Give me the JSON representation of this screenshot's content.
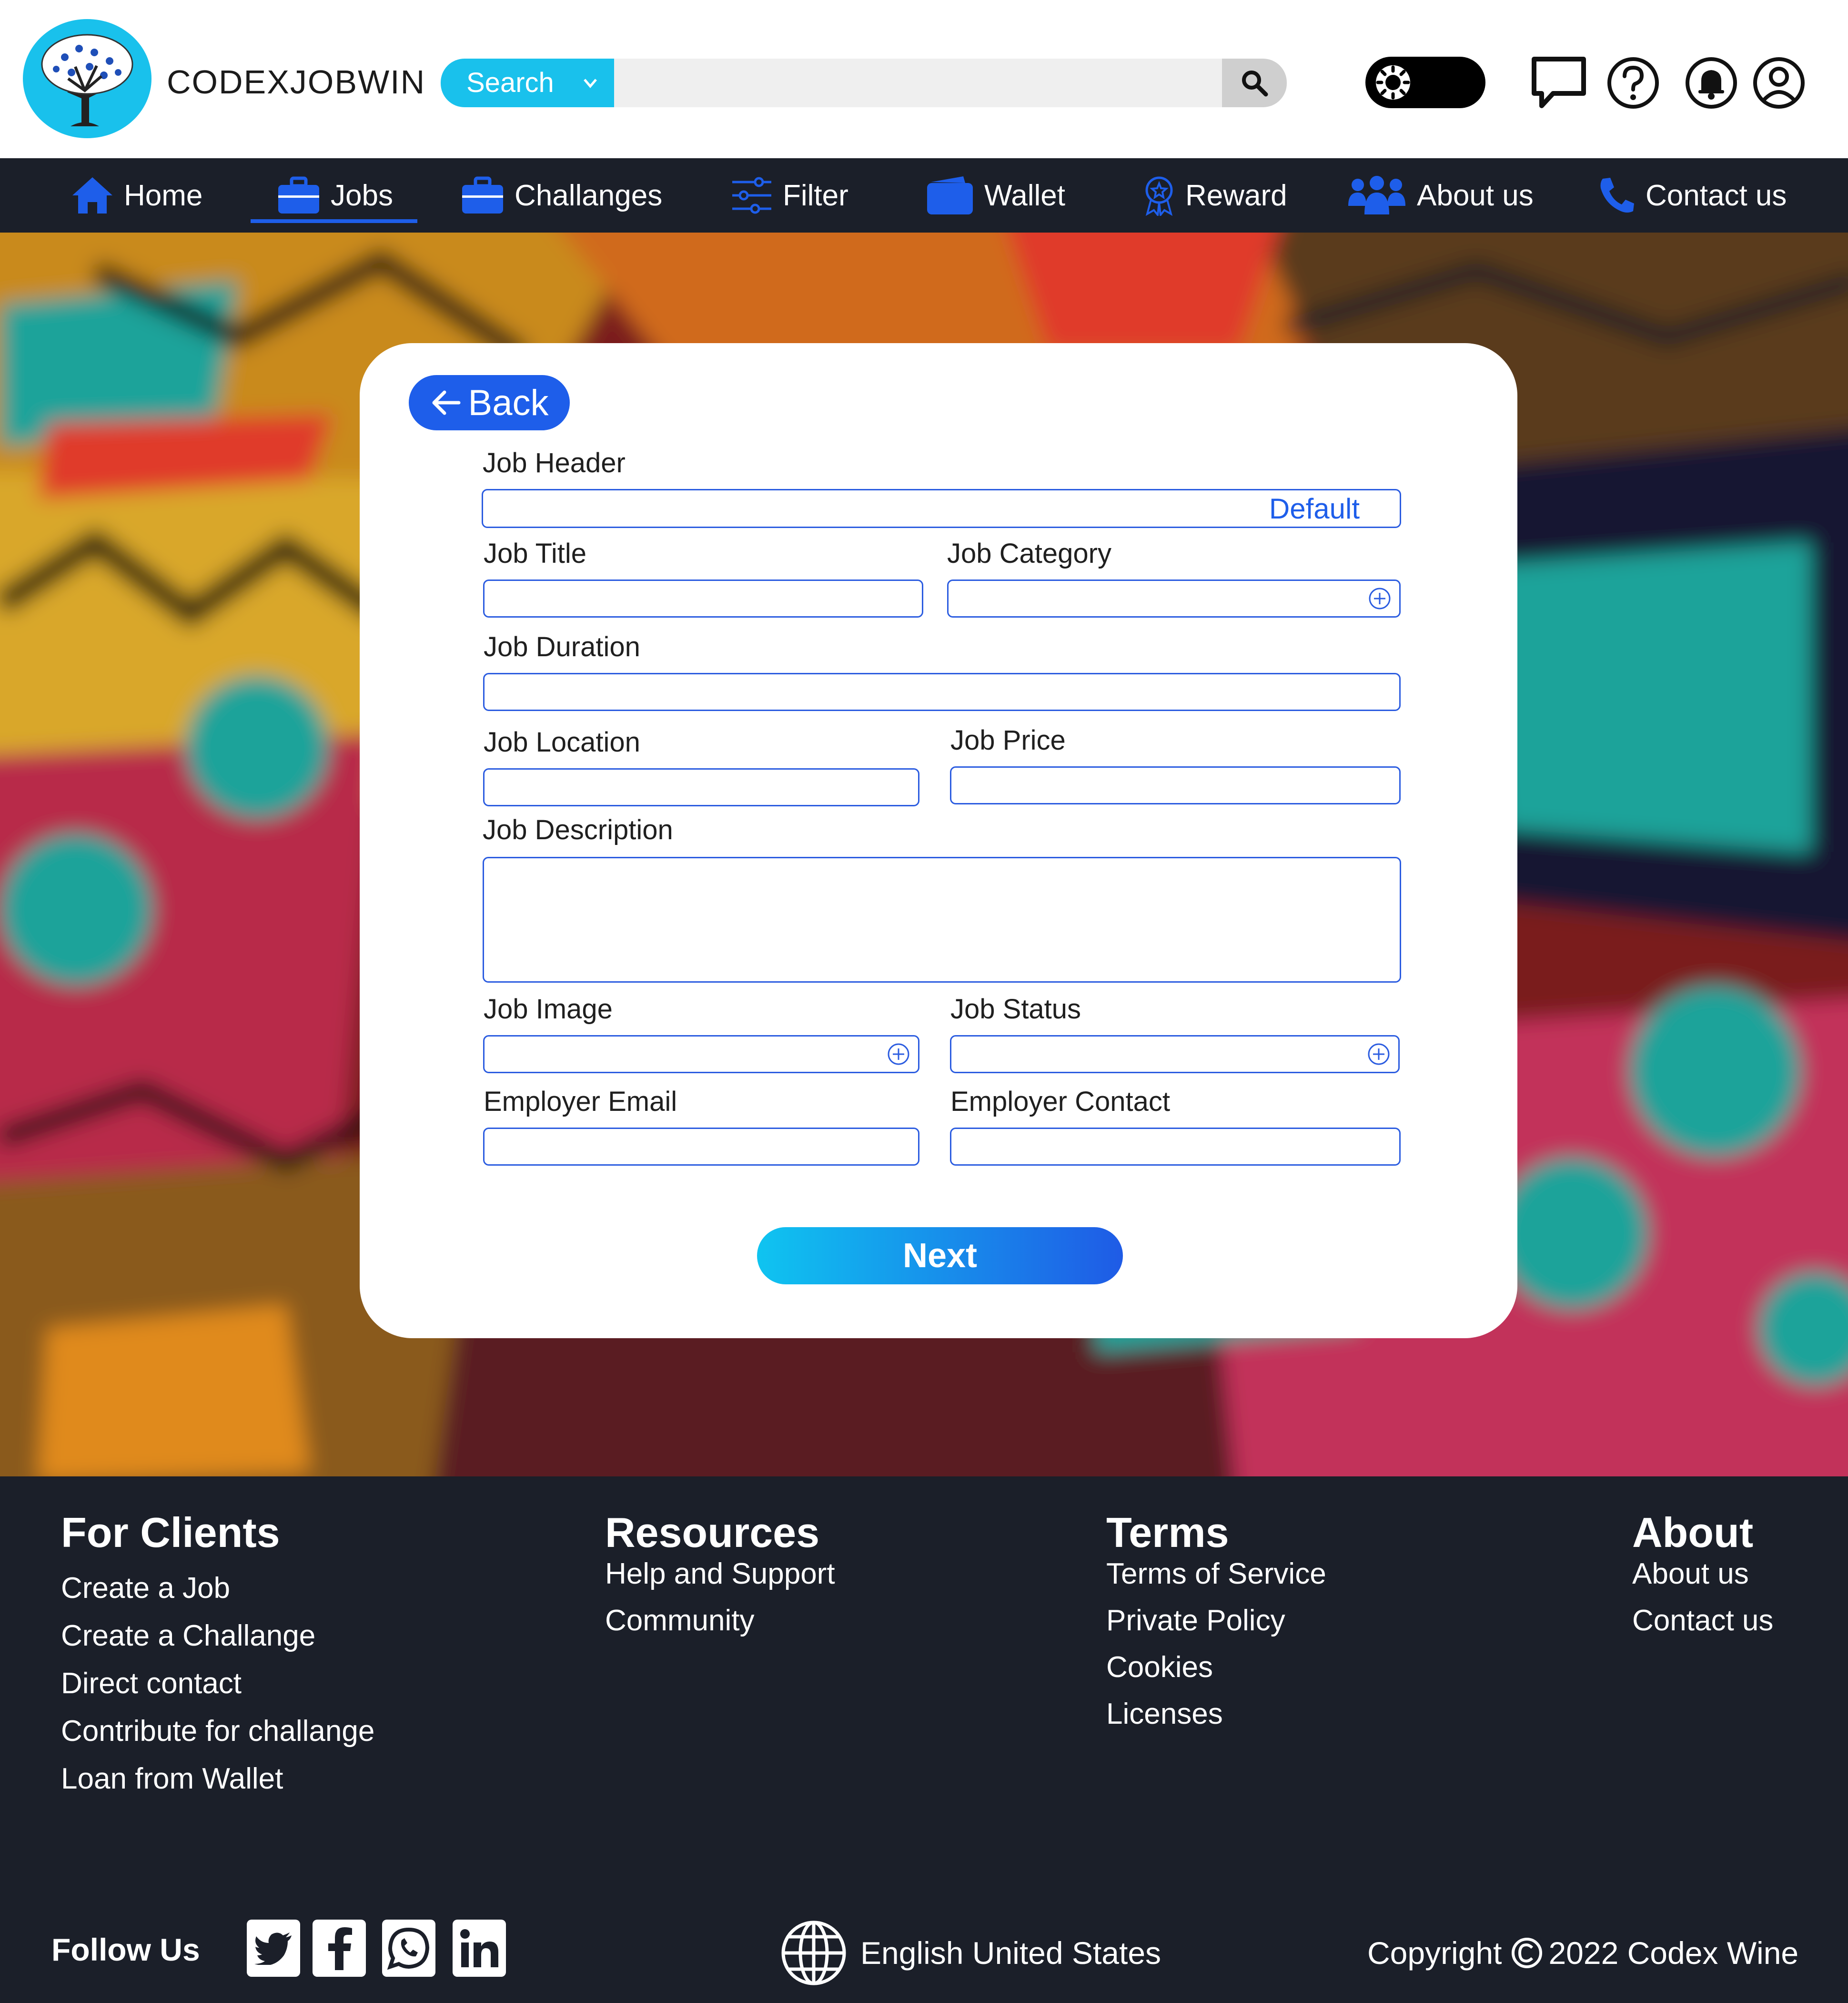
{
  "app": {
    "brand": "CODEXJOBWIN"
  },
  "search": {
    "category_label": "Search",
    "query": "",
    "placeholder": ""
  },
  "header_icons": [
    "theme-toggle-icon",
    "chat-icon",
    "help-icon",
    "bell-icon",
    "user-icon"
  ],
  "nav": {
    "items": [
      {
        "label": "Home",
        "icon": "home-icon"
      },
      {
        "label": "Jobs",
        "icon": "briefcase-icon",
        "active": true
      },
      {
        "label": "Challanges",
        "icon": "briefcase-icon"
      },
      {
        "label": "Filter",
        "icon": "sliders-icon"
      },
      {
        "label": "Wallet",
        "icon": "wallet-icon"
      },
      {
        "label": "Reward",
        "icon": "badge-icon"
      },
      {
        "label": "About us",
        "icon": "group-icon"
      },
      {
        "label": "Contact us",
        "icon": "phone-icon"
      }
    ]
  },
  "form": {
    "back_label": "Back",
    "job_header": {
      "label": "Job Header",
      "value": "Default"
    },
    "job_title": {
      "label": "Job Title",
      "value": ""
    },
    "job_category": {
      "label": "Job Category",
      "value": ""
    },
    "job_duration": {
      "label": "Job Duration",
      "value": ""
    },
    "job_location": {
      "label": "Job Location",
      "value": ""
    },
    "job_price": {
      "label": "Job Price",
      "value": ""
    },
    "job_description": {
      "label": "Job Description",
      "value": ""
    },
    "job_image": {
      "label": "Job Image",
      "value": ""
    },
    "job_status": {
      "label": "Job Status",
      "value": ""
    },
    "employer_email": {
      "label": "Employer Email",
      "value": ""
    },
    "employer_contact": {
      "label": "Employer Contact",
      "value": ""
    },
    "next_label": "Next"
  },
  "footer": {
    "for_clients": {
      "title": "For Clients",
      "links": [
        "Create a Job",
        "Create a Challange",
        "Direct contact",
        "Contribute for challange",
        "Loan from Wallet"
      ]
    },
    "resources": {
      "title": "Resources",
      "links": [
        "Help and Support",
        "Community"
      ]
    },
    "terms": {
      "title": "Terms",
      "links": [
        "Terms of Service",
        "Private Policy",
        "Cookies",
        "Licenses"
      ]
    },
    "about": {
      "title": "About",
      "links": [
        "About us",
        "Contact us"
      ]
    },
    "follow_label": "Follow Us",
    "social": [
      "twitter-icon",
      "facebook-icon",
      "whatsapp-icon",
      "linkedin-icon"
    ],
    "language": "English United States",
    "copyright_prefix": "Copyright",
    "copyright_text": "2022 Codex Wine"
  },
  "colors": {
    "accent": "#1e5eea",
    "cyan": "#19c1ec",
    "dark": "#1b1f29"
  }
}
